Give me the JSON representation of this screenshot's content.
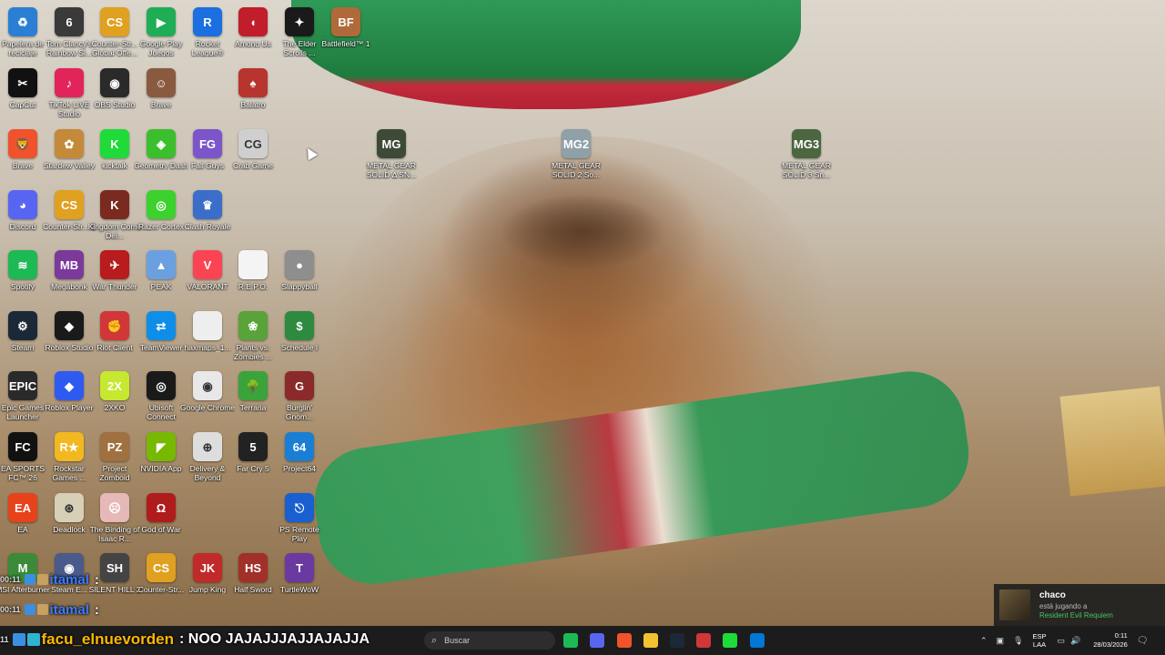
{
  "desktop_icons": [
    {
      "label": "Papelera de reciclaje",
      "icon": "recycle-bin-icon",
      "color": "#2a7fd4",
      "glyph": "♻"
    },
    {
      "label": "Tom Clancy's Rainbow Si...",
      "icon": "rainbow-six-icon",
      "color": "#3a3a3a",
      "glyph": "6"
    },
    {
      "label": "Counter-Str... Global Offe...",
      "icon": "csgo-icon",
      "color": "#e0a020",
      "glyph": "CS"
    },
    {
      "label": "Google Play Juegos",
      "icon": "google-play-games-icon",
      "color": "#1fae56",
      "glyph": "▶"
    },
    {
      "label": "Rocket League®",
      "icon": "rocket-league-icon",
      "color": "#1b6fe0",
      "glyph": "R"
    },
    {
      "label": "Among Us",
      "icon": "among-us-icon",
      "color": "#c21d2a",
      "glyph": "◖"
    },
    {
      "label": "The Elder Scrolls ...",
      "icon": "elder-scrolls-icon",
      "color": "#1a1a1a",
      "glyph": "✦"
    },
    {
      "label": "Battlefield™ 1",
      "icon": "battlefield-icon",
      "color": "#b06a3a",
      "glyph": "BF"
    },
    {
      "label": "CapCut",
      "icon": "capcut-icon",
      "color": "#111111",
      "glyph": "✂"
    },
    {
      "label": "TikTok LIVE Studio",
      "icon": "tiktok-live-icon",
      "color": "#e2245b",
      "glyph": "♪"
    },
    {
      "label": "OBS Studio",
      "icon": "obs-studio-icon",
      "color": "#2a2a2a",
      "glyph": "◉"
    },
    {
      "label": "Brave",
      "icon": "meme-overlay-icon",
      "color": "#8a5a40",
      "glyph": "☺"
    },
    {
      "label": "Balatro",
      "icon": "balatro-icon",
      "color": "#b7352e",
      "glyph": "♠"
    },
    {
      "label": "Brave",
      "icon": "brave-icon",
      "color": "#f0532c",
      "glyph": "🦁"
    },
    {
      "label": "Stardew Valley",
      "icon": "stardew-valley-icon",
      "color": "#c48a3a",
      "glyph": "✿"
    },
    {
      "label": "kicktalk",
      "icon": "kicktalk-icon",
      "color": "#1fdb3a",
      "glyph": "K"
    },
    {
      "label": "Geometry Dash",
      "icon": "geometry-dash-icon",
      "color": "#3cbf2c",
      "glyph": "◈"
    },
    {
      "label": "Fall Guys",
      "icon": "fall-guys-icon",
      "color": "#7b55c9",
      "glyph": "FG"
    },
    {
      "label": "Crab Game",
      "icon": "crab-game-icon",
      "color": "#cfcfcf",
      "glyph": "CG"
    },
    {
      "label": "METAL GEAR SOLID Δ SN...",
      "icon": "mgs-delta-icon",
      "color": "#3d4a38",
      "glyph": "MG"
    },
    {
      "label": "METAL GEAR SOLID 2 So...",
      "icon": "mgs2-icon",
      "color": "#8fa0a8",
      "glyph": "MG2"
    },
    {
      "label": "METAL GEAR SOLID 3 Sn...",
      "icon": "mgs3-icon",
      "color": "#4c6640",
      "glyph": "MG3"
    },
    {
      "label": "Discord",
      "icon": "discord-icon",
      "color": "#5865f2",
      "glyph": "◕"
    },
    {
      "label": "Counter-Str... 2",
      "icon": "cs2-icon",
      "color": "#e0a020",
      "glyph": "CS"
    },
    {
      "label": "Kingdom Come Del...",
      "icon": "kingdom-come-icon",
      "color": "#7a2a1f",
      "glyph": "K"
    },
    {
      "label": "Razer Cortex",
      "icon": "razer-cortex-icon",
      "color": "#3cd12c",
      "glyph": "◎"
    },
    {
      "label": "Clash Royale",
      "icon": "clash-royale-icon",
      "color": "#3b6ec9",
      "glyph": "♛"
    },
    {
      "label": "Spotify",
      "icon": "spotify-icon",
      "color": "#1db954",
      "glyph": "≋"
    },
    {
      "label": "Megabonk",
      "icon": "megabonk-icon",
      "color": "#7b3a9a",
      "glyph": "MB"
    },
    {
      "label": "War Thunder",
      "icon": "war-thunder-icon",
      "color": "#b81c1c",
      "glyph": "✈"
    },
    {
      "label": "PEAK",
      "icon": "peak-icon",
      "color": "#6aa0e0",
      "glyph": "▲"
    },
    {
      "label": "VALORANT",
      "icon": "valorant-icon",
      "color": "#fa4454",
      "glyph": "V"
    },
    {
      "label": "R.E.P.O.",
      "icon": "file-icon",
      "color": "#f4f4f4",
      "glyph": ""
    },
    {
      "label": "Slappyball",
      "icon": "slappyball-icon",
      "color": "#8e8e8e",
      "glyph": "●"
    },
    {
      "label": "Steam",
      "icon": "steam-icon",
      "color": "#1b2838",
      "glyph": "⚙"
    },
    {
      "label": "Roblox Studio",
      "icon": "roblox-studio-icon",
      "color": "#1a1a1a",
      "glyph": "◆"
    },
    {
      "label": "Riot Client",
      "icon": "riot-client-icon",
      "color": "#d13639",
      "glyph": "✊"
    },
    {
      "label": "TeamViewer",
      "icon": "teamviewer-icon",
      "color": "#0e8ee9",
      "glyph": "⇄"
    },
    {
      "label": "haxmaps_1...",
      "icon": "file-icon",
      "color": "#eeeeee",
      "glyph": ""
    },
    {
      "label": "Plants vs. Zombies ...",
      "icon": "pvz-icon",
      "color": "#5aa33a",
      "glyph": "❀"
    },
    {
      "label": "Schedule I",
      "icon": "schedule-one-icon",
      "color": "#2e8a3e",
      "glyph": "$"
    },
    {
      "label": "Epic Games Launcher",
      "icon": "epic-games-icon",
      "color": "#2a2a2a",
      "glyph": "EPIC"
    },
    {
      "label": "Roblox Player",
      "icon": "roblox-player-icon",
      "color": "#2d5bf2",
      "glyph": "◆"
    },
    {
      "label": "2XKO",
      "icon": "2xko-icon",
      "color": "#c6e830",
      "glyph": "2X"
    },
    {
      "label": "Ubisoft Connect",
      "icon": "ubisoft-icon",
      "color": "#1a1a1a",
      "glyph": "◎"
    },
    {
      "label": "Google Chrome",
      "icon": "chrome-icon",
      "color": "#e8e8e8",
      "glyph": "◉"
    },
    {
      "label": "Terraria",
      "icon": "terraria-icon",
      "color": "#3aa33a",
      "glyph": "🌳"
    },
    {
      "label": "Burglin' Gnom...",
      "icon": "burglin-gnomes-icon",
      "color": "#8a2a2a",
      "glyph": "G"
    },
    {
      "label": "EA SPORTS FC™ 26",
      "icon": "ea-fc-icon",
      "color": "#111111",
      "glyph": "FC"
    },
    {
      "label": "Rockstar Games ...",
      "icon": "rockstar-icon",
      "color": "#f2b81f",
      "glyph": "R★"
    },
    {
      "label": "Project Zomboid",
      "icon": "project-zomboid-icon",
      "color": "#a07040",
      "glyph": "PZ"
    },
    {
      "label": "NVIDIA App",
      "icon": "nvidia-icon",
      "color": "#76b900",
      "glyph": "◤"
    },
    {
      "label": "Delivery & Beyond",
      "icon": "delivery-beyond-icon",
      "color": "#dddddd",
      "glyph": "⊕"
    },
    {
      "label": "Far Cry 5",
      "icon": "far-cry-5-icon",
      "color": "#222222",
      "glyph": "5"
    },
    {
      "label": "Project64",
      "icon": "project64-icon",
      "color": "#1a7fd4",
      "glyph": "64"
    },
    {
      "label": "EA",
      "icon": "ea-icon",
      "color": "#e8421b",
      "glyph": "EA"
    },
    {
      "label": "Deadlock",
      "icon": "deadlock-icon",
      "color": "#d8cfb8",
      "glyph": "⊛"
    },
    {
      "label": "The Binding of Isaac R...",
      "icon": "binding-of-isaac-icon",
      "color": "#e6b8b8",
      "glyph": "☹"
    },
    {
      "label": "God of War",
      "icon": "god-of-war-icon",
      "color": "#b01c1c",
      "glyph": "Ω"
    },
    {
      "label": "PS Remote Play",
      "icon": "ps-remote-play-icon",
      "color": "#1a5fd0",
      "glyph": "⎋"
    },
    {
      "label": "MSI Afterburner",
      "icon": "msi-afterburner-icon",
      "color": "#3a8a3a",
      "glyph": "M"
    },
    {
      "label": "Steam E...",
      "icon": "steam-e-icon",
      "color": "#4a5a8a",
      "glyph": "◉"
    },
    {
      "label": "SILENT HILL 2",
      "icon": "silent-hill-icon",
      "color": "#444444",
      "glyph": "SH"
    },
    {
      "label": "Counter-Str...",
      "icon": "cs-icon",
      "color": "#e0a020",
      "glyph": "CS"
    },
    {
      "label": "Jump King",
      "icon": "jump-king-icon",
      "color": "#c02a2a",
      "glyph": "JK"
    },
    {
      "label": "Half Sword",
      "icon": "half-sword-icon",
      "color": "#a03028",
      "glyph": "HS"
    },
    {
      "label": "TurtleWoW",
      "icon": "turtlewow-icon",
      "color": "#6a3aa0",
      "glyph": "T"
    }
  ],
  "chat": [
    {
      "time": "00:11",
      "user": "itamal",
      "message": ":"
    },
    {
      "time": "00:11",
      "user": "itamal",
      "message": ":"
    }
  ],
  "chat_main": {
    "time": "11",
    "user": "facu_elnuevorden",
    "message": ": NOO JAJAJJJAJJAJAJJA"
  },
  "notification": {
    "name": "chaco",
    "subtitle": "está jugando a",
    "game": "Resident Evil Requiem"
  },
  "taskbar": {
    "search_placeholder": "Buscar",
    "apps": [
      {
        "icon": "spotify-taskbar-icon",
        "color": "#1db954"
      },
      {
        "icon": "discord-taskbar-icon",
        "color": "#5865f2"
      },
      {
        "icon": "brave-taskbar-icon",
        "color": "#f0532c"
      },
      {
        "icon": "file-explorer-taskbar-icon",
        "color": "#f2c230"
      },
      {
        "icon": "steam-taskbar-icon",
        "color": "#1b2838"
      },
      {
        "icon": "riot-taskbar-icon",
        "color": "#d13639"
      },
      {
        "icon": "kicktalk-taskbar-icon",
        "color": "#1fdb3a"
      },
      {
        "icon": "capcut-taskbar-icon",
        "color": "#0078d4"
      }
    ],
    "lang_top": "ESP",
    "lang_bottom": "LAA",
    "time": "0:11",
    "date": "28/03/2026"
  }
}
